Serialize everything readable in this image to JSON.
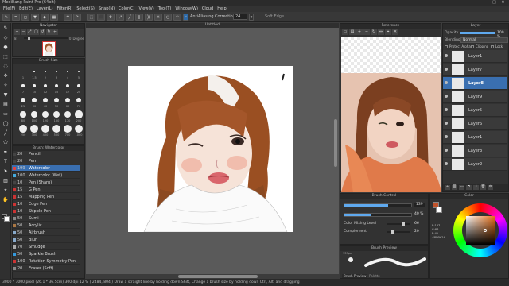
{
  "app": {
    "title": "MediBang Paint Pro (64bit)",
    "win_min": "–",
    "win_max": "□",
    "win_close": "✕"
  },
  "menu": [
    "File(F)",
    "Edit(E)",
    "Layer(L)",
    "Filter(R)",
    "Select(S)",
    "Snap(N)",
    "Color(C)",
    "View(V)",
    "Tool(T)",
    "Window(W)",
    "Cloud",
    "Help"
  ],
  "toolbar": {
    "antialiasing": "AntiAliasing",
    "correction": "Correction",
    "correction_value": "24",
    "soft_edge": "Soft Edge"
  },
  "navigator": {
    "title": "Navigator",
    "zoom": "8",
    "angle": "0",
    "angle_unit": "Degree"
  },
  "brush_size": {
    "title": "Brush Size",
    "sizes": [
      "1",
      "1.5",
      "2",
      "3",
      "4",
      "5",
      "7",
      "10",
      "12",
      "15",
      "17",
      "20",
      "25",
      "30",
      "40",
      "50",
      "60",
      "70",
      "80",
      "100",
      "120",
      "150",
      "170",
      "200",
      "250",
      "300",
      "400",
      "500",
      "700",
      "1000"
    ]
  },
  "brush_list": {
    "title": "Brush: Watercolor",
    "items": [
      {
        "size": "20",
        "name": "Pencil",
        "color": "#444444"
      },
      {
        "size": "20",
        "name": "Pen",
        "color": "#444444"
      },
      {
        "size": "199",
        "name": "Watercolor",
        "color": "#dd4444",
        "selected": true
      },
      {
        "size": "100",
        "name": "Watercolor (Wet)",
        "color": "#44aadd"
      },
      {
        "size": "10",
        "name": "Pen (Sharp)",
        "color": "#444444"
      },
      {
        "size": "15",
        "name": "G Pen",
        "color": "#cc3333"
      },
      {
        "size": "15",
        "name": "Mapping Pen",
        "color": "#cc3333"
      },
      {
        "size": "10",
        "name": "Edge Pen",
        "color": "#cc3333"
      },
      {
        "size": "10",
        "name": "Stipple Pen",
        "color": "#cc3333"
      },
      {
        "size": "50",
        "name": "Sumi",
        "color": "#888888"
      },
      {
        "size": "50",
        "name": "Acrylic",
        "color": "#aa7744"
      },
      {
        "size": "50",
        "name": "Airbrush",
        "color": "#88aacc"
      },
      {
        "size": "50",
        "name": "Blur",
        "color": "#88aacc"
      },
      {
        "size": "70",
        "name": "Smudge",
        "color": "#aaaaaa"
      },
      {
        "size": "50",
        "name": "Sparkle Brush",
        "color": "#3399dd"
      },
      {
        "size": "100",
        "name": "Rotation Symmetry Pen",
        "color": "#cc3333"
      },
      {
        "size": "20",
        "name": "Eraser (Soft)",
        "color": "#888888"
      }
    ]
  },
  "canvas": {
    "tab": "Untitled"
  },
  "reference": {
    "title": "Reference"
  },
  "layer_panel": {
    "title": "Layer",
    "opacity_label": "Opacity",
    "opacity_value": "100 %",
    "blending_label": "Blending",
    "blending_value": "Normal",
    "protect_alpha": "Protect Alpha",
    "clipping": "Clipping",
    "lock": "Lock",
    "layers": [
      {
        "name": "Layer1",
        "selected": false
      },
      {
        "name": "Layer7",
        "selected": false
      },
      {
        "name": "Layer8",
        "selected": true
      },
      {
        "name": "Layer9",
        "selected": false
      },
      {
        "name": "Layer5",
        "selected": false
      },
      {
        "name": "Layer6",
        "selected": false
      },
      {
        "name": "Layer1",
        "selected": false
      },
      {
        "name": "Layer3",
        "selected": false
      },
      {
        "name": "Layer2",
        "selected": false
      }
    ]
  },
  "brush_control": {
    "title": "Brush Control",
    "size_value": "139",
    "opacity_value": "40 %",
    "opacity_level": 0.4,
    "mixing_label": "Color Mixing Level",
    "mixing_value": "66",
    "complement_label": "Complement",
    "complement_value": "20",
    "size_level": 0.65,
    "mixing_level": 0.66,
    "complement_level": 0.2
  },
  "brush_preview": {
    "title": "Brush Preview",
    "size_text": "139px",
    "tab1": "Brush Preview",
    "tab2": "Palette"
  },
  "color": {
    "title": "Color",
    "hex": "#8D5624",
    "r": "R:137",
    "g": "G:86",
    "b": "B:42",
    "fg": "#c0522a",
    "bg": "#ffffff"
  },
  "status": {
    "text": "3000 * 3000 pixel  (26.1 * 36.5cm)  300 dpi  12 %  ( 2484, 804 )  Draw a straight line by holding down Shift, Change a brush size by holding down Ctrl, Alt, and dragging"
  }
}
